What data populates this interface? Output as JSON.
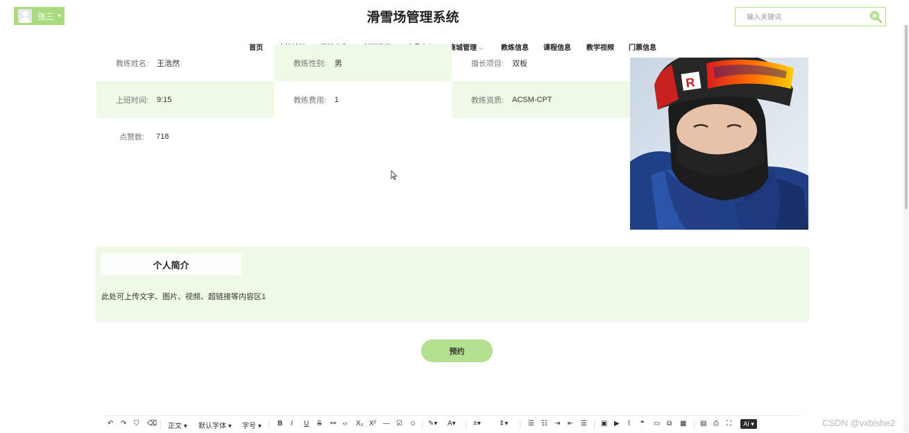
{
  "header": {
    "user_name": "张三",
    "site_title": "滑雪场管理系统",
    "search_placeholder": "输入关键词"
  },
  "nav": {
    "items": [
      "首页",
      "交流论坛",
      "网站公告",
      "新闻资讯",
      "商品中心",
      "商城管理",
      "教练信息",
      "课程信息",
      "教学视频",
      "门票信息"
    ]
  },
  "coach": {
    "name_label": "教练姓名:",
    "name": "王浩然",
    "gender_label": "教练性别:",
    "gender": "男",
    "specialty_label": "擅长项目:",
    "specialty": "双板",
    "shift_label": "上班时间:",
    "shift": "9:15",
    "fee_label": "教练费用:",
    "fee": "1",
    "qualification_label": "教练资质:",
    "qualification": "ACSM-CPT",
    "likes_label": "点赞数:",
    "likes": "718"
  },
  "intro": {
    "title": "个人简介",
    "text": "此处可上传文字、图片、视频、超链接等内容区1"
  },
  "actions": {
    "book_label": "预约"
  },
  "editor_toolbar": {
    "paragraph": "正文",
    "font_family": "默认字体",
    "font_size": "字号",
    "bold": "B",
    "italic": "I",
    "underline": "U",
    "strike": "S",
    "ai": "AI"
  },
  "watermark": "CSDN @vxbishe2",
  "colors": {
    "accent": "#a9dc7e",
    "panel_green": "#eef9e6",
    "button_green": "#b4e08f"
  }
}
